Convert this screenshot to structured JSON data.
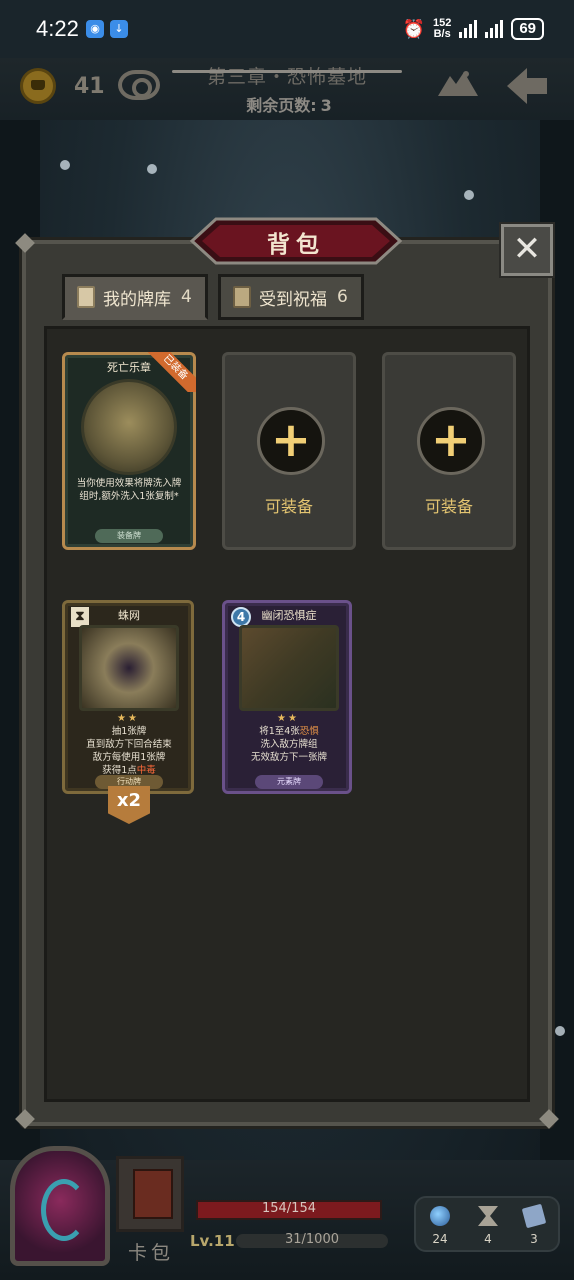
{
  "status_bar": {
    "time": "4:22",
    "net_speed_value": "152",
    "net_speed_unit": "B/s",
    "battery": "69"
  },
  "top_bar": {
    "coins": "41",
    "chapter_title": "第三章・恐怖墓地",
    "pages_left_label": "剩余页数:",
    "pages_left_value": "3"
  },
  "backpack": {
    "title": "背包",
    "close_label": "✕",
    "tabs": [
      {
        "label": "我的牌库",
        "count": "4",
        "active": true
      },
      {
        "label": "受到祝福",
        "count": "6",
        "active": false
      }
    ],
    "equipment_row": {
      "equipped_card": {
        "title": "死亡乐章",
        "badge": "已装备",
        "description": "当你使用效果将牌洗入牌组时,额外洗入1张复制*",
        "type": "装备牌"
      },
      "empty_slots": [
        {
          "label": "可装备"
        },
        {
          "label": "可装备"
        }
      ]
    },
    "deck_cards": [
      {
        "title": "蛛网",
        "cost_icon": "hourglass-icon",
        "stars": "★★",
        "description_parts": [
          "抽1张牌",
          "直到敌方下回合结束",
          "敌方每使用1张牌",
          "获得1点"
        ],
        "highlight": "中毒",
        "type": "行动牌",
        "multiplier": "x2"
      },
      {
        "title": "幽闭恐惧症",
        "cost": "4",
        "stars": "★★",
        "description_pre": "将1至4张",
        "highlight": "恐惧",
        "description_post": [
          "洗入敌方牌组",
          "无效敌方下一张牌"
        ],
        "type": "元素牌"
      }
    ]
  },
  "hud": {
    "deck_label": "卡包",
    "hp": "154/154",
    "hp_fraction": 1.0,
    "level": "Lv.11",
    "xp": "31/1000",
    "resources": [
      {
        "icon": "orb-icon",
        "value": "24"
      },
      {
        "icon": "hourglass-icon",
        "value": "4"
      },
      {
        "icon": "cards-icon",
        "value": "3"
      }
    ]
  },
  "colors": {
    "accent_gold": "#e4c571",
    "banner_red": "#6a1420",
    "hp_red": "#7c1a1e",
    "equipped_orange": "#d26a2e"
  }
}
